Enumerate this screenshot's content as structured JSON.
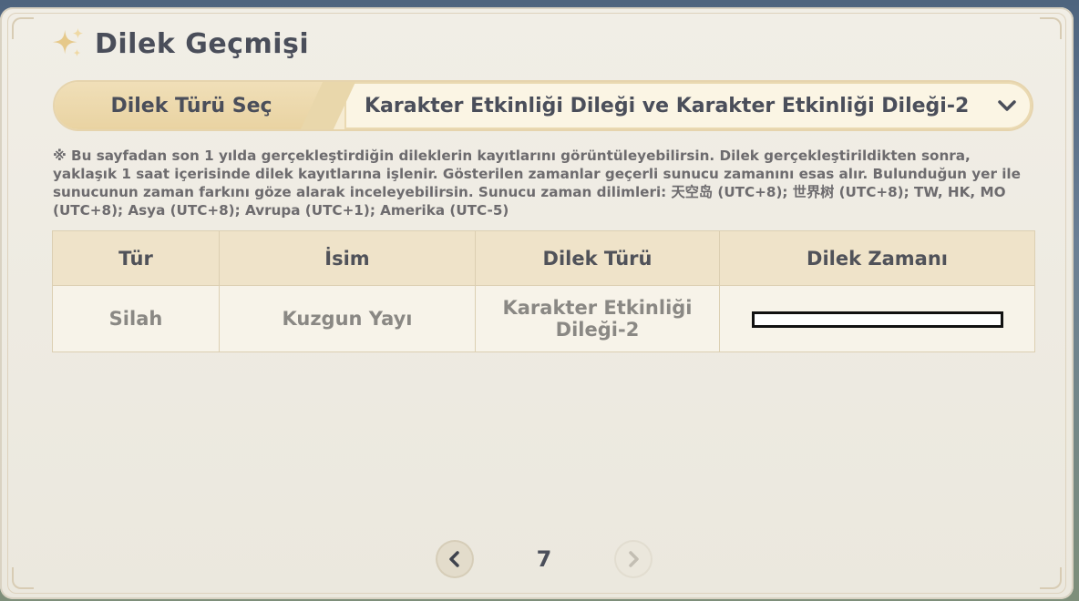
{
  "header": {
    "title": "Dilek Geçmişi",
    "icon": "sparkle-icon"
  },
  "selector": {
    "label": "Dilek Türü Seç",
    "value": "Karakter Etkinliği Dileği ve Karakter Etkinliği Dileği-2",
    "icon": "chevron-down-icon"
  },
  "notice": "※ Bu sayfadan son 1 yılda gerçekleştirdiğin dileklerin kayıtlarını görüntüleyebilirsin. Dilek gerçekleştirildikten sonra, yaklaşık 1 saat içerisinde dilek kayıtlarına işlenir. Gösterilen zamanlar geçerli sunucu zamanını esas alır. Bulunduğun yer ile sunucunun zaman farkını göze alarak inceleyebilirsin. Sunucu zaman dilimleri: 天空岛 (UTC+8); 世界树 (UTC+8); TW, HK, MO (UTC+8); Asya (UTC+8); Avrupa (UTC+1); Amerika (UTC-5)",
  "table": {
    "headers": [
      "Tür",
      "İsim",
      "Dilek Türü",
      "Dilek Zamanı"
    ],
    "rows": [
      {
        "type": "Silah",
        "name": "Kuzgun Yayı",
        "wish_type": "Karakter Etkinliği Dileği-2",
        "time": ""
      }
    ]
  },
  "pagination": {
    "page": "7",
    "prev_icon": "chevron-left-icon",
    "next_icon": "chevron-right-icon"
  },
  "colors": {
    "text_dark": "#4a4e5a",
    "header_bg": "#efe3c9",
    "row_bg": "#f7f3e9",
    "panel_bg": "#f1eee6"
  }
}
